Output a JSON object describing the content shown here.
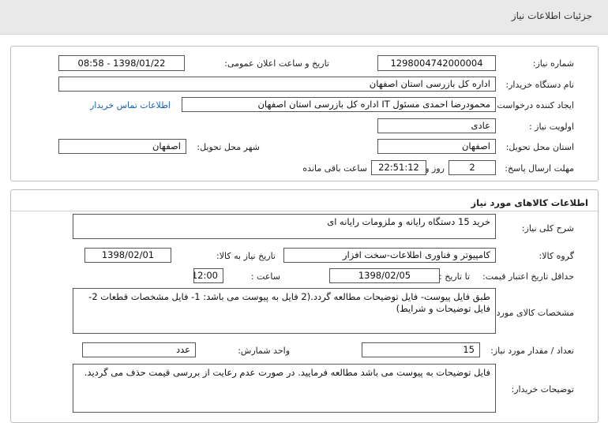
{
  "header": {
    "title": "جزئیات اطلاعات نیاز"
  },
  "info": {
    "need_number_label": "شماره نیاز:",
    "need_number": "1298004742000004",
    "announce_label": "تاریخ و ساعت اعلان عمومی:",
    "announce_value": "1398/01/22 - 08:58",
    "buyer_org_label": "نام دستگاه خریدار:",
    "buyer_org": "اداره کل بازرسی استان اصفهان",
    "requester_label": "ایجاد کننده درخواست:",
    "requester": "محمودرضا احمدی مسئول IT اداره کل بازرسی استان اصفهان",
    "contact_link": "اطلاعات تماس خریدار",
    "priority_label": "اولویت نیاز :",
    "priority": "عادی",
    "province_label": "استان محل تحویل:",
    "province": "اصفهان",
    "city_label": "شهر محل تحویل:",
    "city": "اصفهان",
    "deadline_label": "مهلت ارسال پاسخ:",
    "days": "2",
    "days_suffix": "روز و",
    "time_left": "22:51:12",
    "time_left_suffix": "ساعت باقی مانده"
  },
  "goods": {
    "section_title": "اطلاعات کالاهای مورد نیاز",
    "summary_label": "شرح کلی نیاز:",
    "summary": "خرید 15 دستگاه رایانه و ملزومات رایانه ای",
    "group_label": "گروه کالا:",
    "group": "کامپیوتر و فناوری اطلاعات-سخت افزار",
    "need_date_label": "تاریخ نیاز به کالا:",
    "need_date": "1398/02/01",
    "validity_label": "حداقل تاریخ اعتبار قیمت:",
    "validity_until_label": "تا تاریخ :",
    "validity_date": "1398/02/05",
    "validity_time_label": "ساعت :",
    "validity_time": "12:00",
    "specs_label": "مشخصات کالای مورد نیاز:",
    "specs": "طبق فایل پیوست- فایل توضیحات مطالعه گردد.(2 فایل به پیوست می باشد: 1- فایل مشخصات قطعات 2- فایل توضیحات و شرایط)",
    "quantity_label": "تعداد / مقدار مورد نیاز:",
    "quantity": "15",
    "unit_label": "واحد شمارش:",
    "unit": "عدد",
    "notes_label": "توضیحات خریدار:",
    "notes": "فایل توضیحات به پیوست می باشد مطالعه فرمایید. در صورت عدم رعایت از بررسی قیمت حذف می گردید."
  }
}
